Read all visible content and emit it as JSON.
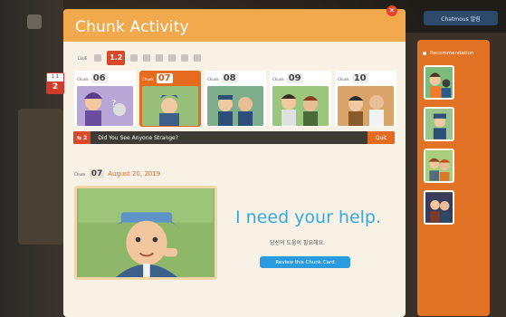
{
  "modal": {
    "title": "Chunk Activity",
    "close_icon": "close-icon"
  },
  "progress": {
    "label": "CLUE",
    "active_step": "1.2",
    "step_count": 8
  },
  "side_badge": {
    "top": "1.1",
    "bottom": "2"
  },
  "chunks": [
    {
      "word": "Chunk",
      "number": "06",
      "active": false
    },
    {
      "word": "Chunk",
      "number": "07",
      "active": true
    },
    {
      "word": "Chunk",
      "number": "08",
      "active": false
    },
    {
      "word": "Chunk",
      "number": "09",
      "active": false
    },
    {
      "word": "Chunk",
      "number": "10",
      "active": false
    }
  ],
  "episode": {
    "number": "2",
    "title": "Did You See Anyone Strange?",
    "quit_label": "Quit"
  },
  "detail": {
    "chunk_word": "Chunk",
    "chunk_number": "07",
    "date": "August 20, 2019",
    "phrase": "I need your help.",
    "translation": "당신의 도움이 필요해요.",
    "review_label": "Review this Chunk Card"
  },
  "recommendation": {
    "label": "Recommendation",
    "count": 4
  },
  "user_label": "Chatmous 알림"
}
